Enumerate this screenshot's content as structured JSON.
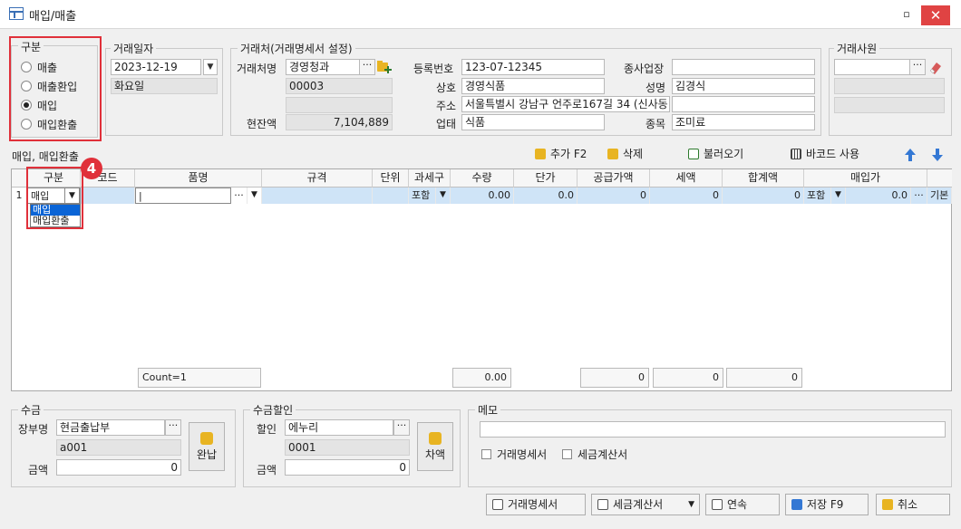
{
  "window": {
    "title": "매입/매출",
    "restore": "▫",
    "close": "✕"
  },
  "gubun": {
    "legend": "구분",
    "options": [
      "매출",
      "매출환입",
      "매입",
      "매입환출"
    ],
    "selected": 2
  },
  "date": {
    "legend": "거래일자",
    "value": "2023-12-19",
    "weekday": "화요일"
  },
  "partner": {
    "legend": "거래처(거래명세서 설정)",
    "name_label": "거래처명",
    "name": "경영청과",
    "code": "00003",
    "balance_label": "현잔액",
    "balance": "7,104,889",
    "reg_label": "등록번호",
    "reg_no": "123-07-12345",
    "company_label": "상호",
    "company": "경영식품",
    "address_label": "주소",
    "address": "서울특별시 강남구 언주로167길 34 (신사동",
    "biz_label": "업태",
    "biz": "식품",
    "branch_label": "종사업장",
    "branch": "",
    "owner_label": "성명",
    "owner": "김경식",
    "item_label": "종목",
    "item": "조미료"
  },
  "staff": {
    "legend": "거래사원",
    "value": ""
  },
  "toolbar": {
    "section_label": "매입, 매입환출",
    "add": "추가 F2",
    "delete": "삭제",
    "load": "불러오기",
    "barcode": "바코드 사용"
  },
  "grid": {
    "headers": [
      "구분",
      "코드",
      "품명",
      "규격",
      "단위",
      "과세구",
      "수량",
      "단가",
      "공급가액",
      "세액",
      "합계액",
      "매입가"
    ],
    "row": {
      "no": "1",
      "gubun": "매입",
      "code": "",
      "name": "|",
      "spec": "",
      "unit": "",
      "tax": "포함",
      "qty": "0.00",
      "price": "0.0",
      "supply": "0",
      "vat": "0",
      "total": "0",
      "buy_tax": "포함",
      "buy_price": "0.0",
      "basis": "기본"
    },
    "dropdown_options": [
      "매입",
      "매입환출"
    ],
    "footer": {
      "count": "Count=1",
      "qty": "0.00",
      "supply": "0",
      "vat": "0",
      "total": "0"
    }
  },
  "badge": "4",
  "receipt": {
    "legend": "수금",
    "ledger_label": "장부명",
    "ledger": "현금출납부",
    "code": "a001",
    "amount_label": "금액",
    "amount": "0",
    "button": "완납"
  },
  "discount": {
    "legend": "수금할인",
    "label": "할인",
    "value": "에누리",
    "code": "0001",
    "amount_label": "금액",
    "amount": "0",
    "button": "차액"
  },
  "memo": {
    "legend": "메모",
    "value": "",
    "chk1": "거래명세서",
    "chk2": "세금계산서"
  },
  "bottom": {
    "statement": "거래명세서",
    "tax_invoice": "세금계산서",
    "continue": "연속",
    "save": "저장 F9",
    "cancel": "취소"
  },
  "colors": {
    "accent": "#e0303a",
    "selection": "#cfe4f7",
    "close": "#e04343"
  }
}
